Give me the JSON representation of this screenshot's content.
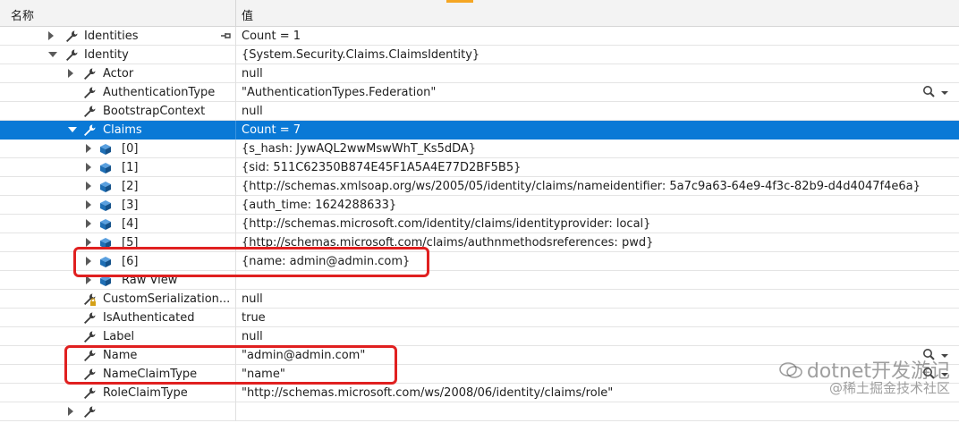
{
  "header": {
    "name_col": "名称",
    "value_col": "值"
  },
  "rows": [
    {
      "name": "Identities",
      "value": "Count = 1",
      "indent": 0,
      "expander": "collapsed",
      "icon": "wrench-icon",
      "pin": "pin-icon"
    },
    {
      "name": "Identity",
      "value": "{System.Security.Claims.ClaimsIdentity}",
      "indent": 0,
      "expander": "expanded",
      "icon": "wrench-icon"
    },
    {
      "name": "Actor",
      "value": "null",
      "indent": 1,
      "expander": "collapsed",
      "icon": "wrench-icon"
    },
    {
      "name": "AuthenticationType",
      "value": "\"AuthenticationTypes.Federation\"",
      "indent": 1,
      "expander": "none",
      "icon": "wrench-icon",
      "visualizer": "magnifier-icon"
    },
    {
      "name": "BootstrapContext",
      "value": "null",
      "indent": 1,
      "expander": "none",
      "icon": "wrench-icon"
    },
    {
      "name": "Claims",
      "value": "Count = 7",
      "indent": 1,
      "expander": "expanded",
      "icon": "wrench-icon",
      "selected": true
    },
    {
      "name": "[0]",
      "value": "{s_hash: JywAQL2wwMswWhT_Ks5dDA}",
      "indent": 2,
      "expander": "collapsed",
      "icon": "object-cube-icon"
    },
    {
      "name": "[1]",
      "value": "{sid: 511C62350B874E45F1A5A4E77D2BF5B5}",
      "indent": 2,
      "expander": "collapsed",
      "icon": "object-cube-icon"
    },
    {
      "name": "[2]",
      "value": "{http://schemas.xmlsoap.org/ws/2005/05/identity/claims/nameidentifier: 5a7c9a63-64e9-4f3c-82b9-d4d4047f4e6a}",
      "indent": 2,
      "expander": "collapsed",
      "icon": "object-cube-icon"
    },
    {
      "name": "[3]",
      "value": "{auth_time: 1624288633}",
      "indent": 2,
      "expander": "collapsed",
      "icon": "object-cube-icon"
    },
    {
      "name": "[4]",
      "value": "{http://schemas.microsoft.com/identity/claims/identityprovider: local}",
      "indent": 2,
      "expander": "collapsed",
      "icon": "object-cube-icon"
    },
    {
      "name": "[5]",
      "value": "{http://schemas.microsoft.com/claims/authnmethodsreferences: pwd}",
      "indent": 2,
      "expander": "collapsed",
      "icon": "object-cube-icon"
    },
    {
      "name": "[6]",
      "value": "{name: admin@admin.com}",
      "indent": 2,
      "expander": "collapsed",
      "icon": "object-cube-icon"
    },
    {
      "name": "Raw View",
      "value": "",
      "indent": 2,
      "expander": "collapsed",
      "icon": "object-cube-icon"
    },
    {
      "name": "CustomSerialization...",
      "value": "null",
      "indent": 1,
      "expander": "none",
      "icon": "wrench-lock-icon"
    },
    {
      "name": "IsAuthenticated",
      "value": "true",
      "indent": 1,
      "expander": "none",
      "icon": "wrench-icon"
    },
    {
      "name": "Label",
      "value": "null",
      "indent": 1,
      "expander": "none",
      "icon": "wrench-icon"
    },
    {
      "name": "Name",
      "value": "\"admin@admin.com\"",
      "indent": 1,
      "expander": "none",
      "icon": "wrench-icon",
      "visualizer": "magnifier-icon"
    },
    {
      "name": "NameClaimType",
      "value": "\"name\"",
      "indent": 1,
      "expander": "none",
      "icon": "wrench-icon",
      "visualizer": "magnifier-icon"
    },
    {
      "name": "RoleClaimType",
      "value": "\"http://schemas.microsoft.com/ws/2008/06/identity/claims/role\"",
      "indent": 1,
      "expander": "none",
      "icon": "wrench-icon"
    },
    {
      "name": "",
      "value": "",
      "indent": 1,
      "expander": "collapsed",
      "icon": "wrench-icon",
      "partial": true
    }
  ],
  "watermark": {
    "line1": "dotnet开发游记",
    "line2": "@稀土掘金技术社区"
  },
  "colors": {
    "selection": "#0a79d6",
    "highlight_box": "#e02020",
    "wrench": "#3c3c3c",
    "cube": "#1f6fb5"
  }
}
